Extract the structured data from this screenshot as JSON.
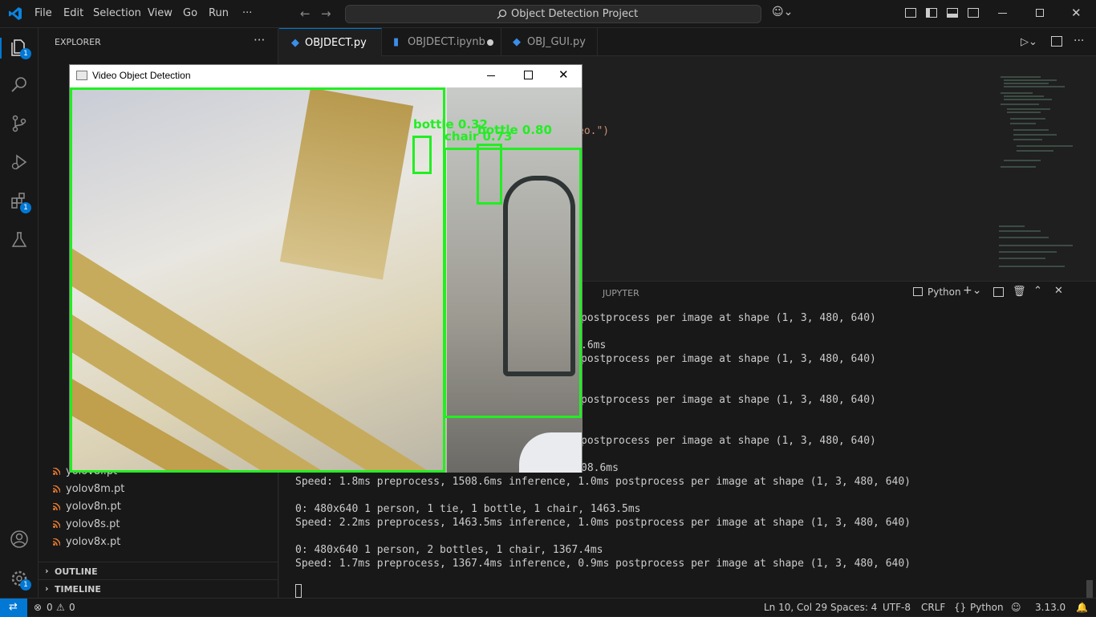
{
  "titlebar": {
    "menus": [
      "File",
      "Edit",
      "Selection",
      "View",
      "Go",
      "Run",
      "···"
    ],
    "search_text": "Object Detection Project"
  },
  "activity": {
    "explorer_badge": "1",
    "extensions_badge": "1",
    "settings_badge": "1"
  },
  "sidebar": {
    "header": "EXPLORER",
    "files": [
      "yolov8l.pt",
      "yolov8m.pt",
      "yolov8n.pt",
      "yolov8s.pt",
      "yolov8x.pt"
    ],
    "outline": "OUTLINE",
    "timeline": "TIMELINE"
  },
  "tabs": [
    {
      "label": "OBJDECT.py",
      "active": true
    },
    {
      "label": "OBJDECT.ipynb",
      "active": false
    },
    {
      "label": "OBJ_GUI.py",
      "active": false
    }
  ],
  "editor": {
    "code_fragment": "eo.\")"
  },
  "panel": {
    "tab_jupyter": "JUPYTER",
    "terminal_profile": "Python",
    "lines": [
      "postprocess per image at shape (1, 3, 480, 640)",
      ".6ms",
      "postprocess per image at shape (1, 3, 480, 640)",
      "postprocess per image at shape (1, 3, 480, 640)",
      "postprocess per image at shape (1, 3, 480, 640)",
      "08.6ms",
      "Speed: 1.8ms preprocess, 1508.6ms inference, 1.0ms postprocess per image at shape (1, 3, 480, 640)",
      "0: 480x640 1 person, 1 tie, 1 bottle, 1 chair, 1463.5ms",
      "Speed: 2.2ms preprocess, 1463.5ms inference, 1.0ms postprocess per image at shape (1, 3, 480, 640)",
      "0: 480x640 1 person, 2 bottles, 1 chair, 1367.4ms",
      "Speed: 1.7ms preprocess, 1367.4ms inference, 0.9ms postprocess per image at shape (1, 3, 480, 640)"
    ]
  },
  "statusbar": {
    "errors": "0",
    "warnings": "0",
    "position": "Ln 10, Col 29",
    "spaces": "Spaces: 4",
    "encoding": "UTF-8",
    "eol": "CRLF",
    "language": "Python",
    "python_version": "3.13.0"
  },
  "video_window": {
    "title": "Video Object Detection",
    "detections": [
      {
        "label": "bottle",
        "score": "0.32"
      },
      {
        "label": "bottle",
        "score": "0.80"
      },
      {
        "label": "chair",
        "score": "0.73"
      }
    ],
    "detection_texts": [
      "bottle  0.32",
      "bottle  0.80",
      "chair  0.73"
    ]
  },
  "colors": {
    "accent": "#0078d4",
    "detection_box": "#22ee22",
    "python_icon": "#3b8eea",
    "rss_icon": "#e37933"
  }
}
